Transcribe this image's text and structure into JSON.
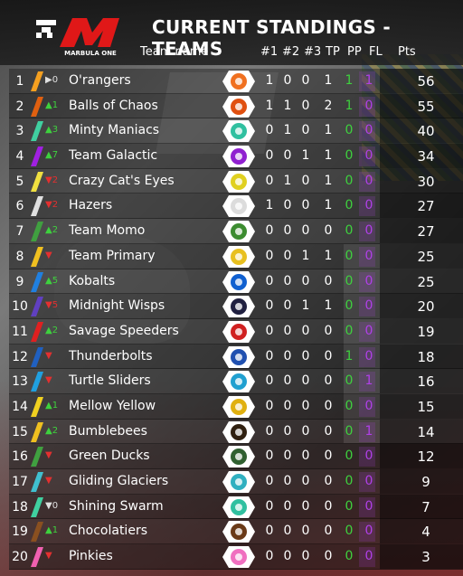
{
  "header": {
    "title": "CURRENT STANDINGS - TEAMS",
    "logo_text": "MARBULA ONE",
    "columns": {
      "team": "Team name",
      "c1": "#1",
      "c2": "#2",
      "c3": "#3",
      "tp": "TP",
      "pp": "PP",
      "fl": "FL",
      "pts": "Pts"
    }
  },
  "rows": [
    {
      "pos": "1",
      "change": "▶0",
      "dir": "same",
      "name": "O'rangers",
      "color": "#f5a020",
      "badge": "#f07020",
      "n1": "1",
      "n2": "0",
      "n3": "0",
      "tp": "1",
      "pp": "1",
      "fl": "1",
      "pts": "56"
    },
    {
      "pos": "2",
      "change": "▲1",
      "dir": "up",
      "name": "Balls of Chaos",
      "color": "#e06010",
      "badge": "#e05010",
      "n1": "1",
      "n2": "1",
      "n3": "0",
      "tp": "2",
      "pp": "1",
      "fl": "0",
      "pts": "55"
    },
    {
      "pos": "3",
      "change": "▲3",
      "dir": "up",
      "name": "Minty Maniacs",
      "color": "#40d0a0",
      "badge": "#30c0a0",
      "n1": "0",
      "n2": "1",
      "n3": "0",
      "tp": "1",
      "pp": "0",
      "fl": "0",
      "pts": "40"
    },
    {
      "pos": "4",
      "change": "▲7",
      "dir": "up",
      "name": "Team Galactic",
      "color": "#a020e0",
      "badge": "#9020d0",
      "n1": "0",
      "n2": "0",
      "n3": "1",
      "tp": "1",
      "pp": "0",
      "fl": "0",
      "pts": "34"
    },
    {
      "pos": "5",
      "change": "▼2",
      "dir": "down",
      "name": "Crazy Cat's Eyes",
      "color": "#f0e040",
      "badge": "#e0d020",
      "n1": "0",
      "n2": "1",
      "n3": "0",
      "tp": "1",
      "pp": "0",
      "fl": "0",
      "pts": "30"
    },
    {
      "pos": "6",
      "change": "▼2",
      "dir": "down",
      "name": "Hazers",
      "color": "#e0e0e0",
      "badge": "#dcdcdc",
      "n1": "1",
      "n2": "0",
      "n3": "0",
      "tp": "1",
      "pp": "0",
      "fl": "0",
      "pts": "27"
    },
    {
      "pos": "7",
      "change": "▲2",
      "dir": "up",
      "name": "Team Momo",
      "color": "#40a040",
      "badge": "#3c8c30",
      "n1": "0",
      "n2": "0",
      "n3": "0",
      "tp": "0",
      "pp": "0",
      "fl": "0",
      "pts": "27"
    },
    {
      "pos": "8",
      "change": "▼",
      "dir": "down",
      "name": "Team Primary",
      "color": "#f0c020",
      "badge": "#e8c020",
      "n1": "0",
      "n2": "0",
      "n3": "1",
      "tp": "1",
      "pp": "0",
      "fl": "0",
      "pts": "25"
    },
    {
      "pos": "9",
      "change": "▲5",
      "dir": "up",
      "name": "Kobalts",
      "color": "#2080e0",
      "badge": "#1060d0",
      "n1": "0",
      "n2": "0",
      "n3": "0",
      "tp": "0",
      "pp": "0",
      "fl": "0",
      "pts": "25"
    },
    {
      "pos": "10",
      "change": "▼5",
      "dir": "down",
      "name": "Midnight Wisps",
      "color": "#6040c0",
      "badge": "#202040",
      "n1": "0",
      "n2": "0",
      "n3": "1",
      "tp": "1",
      "pp": "0",
      "fl": "0",
      "pts": "20"
    },
    {
      "pos": "11",
      "change": "▲2",
      "dir": "up",
      "name": "Savage Speeders",
      "color": "#e02020",
      "badge": "#d02020",
      "n1": "0",
      "n2": "0",
      "n3": "0",
      "tp": "0",
      "pp": "0",
      "fl": "0",
      "pts": "19"
    },
    {
      "pos": "12",
      "change": "▼",
      "dir": "down",
      "name": "Thunderbolts",
      "color": "#2060c0",
      "badge": "#2050b0",
      "n1": "0",
      "n2": "0",
      "n3": "0",
      "tp": "0",
      "pp": "1",
      "fl": "0",
      "pts": "18"
    },
    {
      "pos": "13",
      "change": "▼",
      "dir": "down",
      "name": "Turtle Sliders",
      "color": "#20a0e0",
      "badge": "#20a0d0",
      "n1": "0",
      "n2": "0",
      "n3": "0",
      "tp": "0",
      "pp": "0",
      "fl": "1",
      "pts": "16"
    },
    {
      "pos": "14",
      "change": "▲1",
      "dir": "up",
      "name": "Mellow Yellow",
      "color": "#f0d020",
      "badge": "#e0b010",
      "n1": "0",
      "n2": "0",
      "n3": "0",
      "tp": "0",
      "pp": "0",
      "fl": "0",
      "pts": "15"
    },
    {
      "pos": "15",
      "change": "▲2",
      "dir": "up",
      "name": "Bumblebees",
      "color": "#f0c020",
      "badge": "#302010",
      "n1": "0",
      "n2": "0",
      "n3": "0",
      "tp": "0",
      "pp": "0",
      "fl": "1",
      "pts": "14"
    },
    {
      "pos": "16",
      "change": "▼",
      "dir": "down",
      "name": "Green Ducks",
      "color": "#40a040",
      "badge": "#306030",
      "n1": "0",
      "n2": "0",
      "n3": "0",
      "tp": "0",
      "pp": "0",
      "fl": "0",
      "pts": "12"
    },
    {
      "pos": "17",
      "change": "▼",
      "dir": "down",
      "name": "Gliding Glaciers",
      "color": "#40c0d0",
      "badge": "#30b0c0",
      "n1": "0",
      "n2": "0",
      "n3": "0",
      "tp": "0",
      "pp": "0",
      "fl": "0",
      "pts": "9"
    },
    {
      "pos": "18",
      "change": "▼0",
      "dir": "same",
      "name": "Shining Swarm",
      "color": "#40d0a0",
      "badge": "#30c0a0",
      "n1": "0",
      "n2": "0",
      "n3": "0",
      "tp": "0",
      "pp": "0",
      "fl": "0",
      "pts": "7"
    },
    {
      "pos": "19",
      "change": "▲1",
      "dir": "up",
      "name": "Chocolatiers",
      "color": "#8a5020",
      "badge": "#6a3a18",
      "n1": "0",
      "n2": "0",
      "n3": "0",
      "tp": "0",
      "pp": "0",
      "fl": "0",
      "pts": "4"
    },
    {
      "pos": "20",
      "change": "▼",
      "dir": "down",
      "name": "Pinkies",
      "color": "#f060b0",
      "badge": "#f070c0",
      "n1": "0",
      "n2": "0",
      "n3": "0",
      "tp": "0",
      "pp": "0",
      "fl": "0",
      "pts": "3"
    }
  ]
}
